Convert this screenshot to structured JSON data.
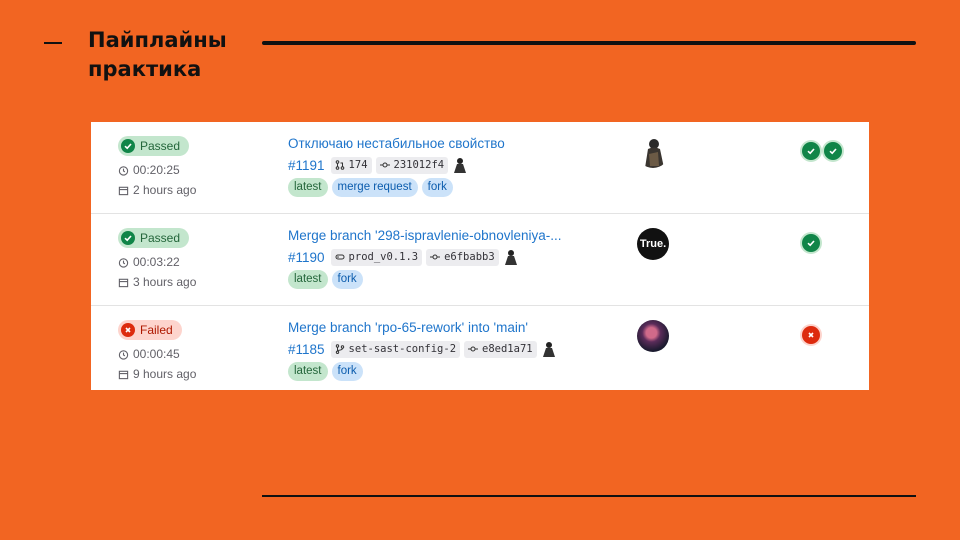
{
  "slide": {
    "title": "Пайплайны практика"
  },
  "pipelines": [
    {
      "status": "Passed",
      "status_kind": "passed",
      "duration": "00:20:25",
      "finished": "2 hours ago",
      "title": "Отключаю нестабильное свойство",
      "id": "#1191",
      "ref_icon": "merge-request-icon",
      "ref": "174",
      "commit": "231012f4",
      "tags": [
        "latest",
        "merge request",
        "fork"
      ],
      "avatar": "hooded-figure-avatar",
      "stages": [
        "success",
        "success"
      ]
    },
    {
      "status": "Passed",
      "status_kind": "passed",
      "duration": "00:03:22",
      "finished": "3 hours ago",
      "title": "Merge branch '298-ispravlenie-obnovleniya-...",
      "id": "#1190",
      "ref_icon": "tag-icon",
      "ref": "prod_v0.1.3",
      "commit": "e6fbabb3",
      "tags": [
        "latest",
        "fork"
      ],
      "avatar_text": "True.",
      "stages": [
        "success"
      ]
    },
    {
      "status": "Failed",
      "status_kind": "failed",
      "duration": "00:00:45",
      "finished": "9 hours ago",
      "title": "Merge branch 'rpo-65-rework' into 'main'",
      "id": "#1185",
      "ref_icon": "branch-icon",
      "ref": "set-sast-config-2",
      "commit": "e8ed1a71",
      "tags": [
        "latest",
        "fork"
      ],
      "avatar": "photo-avatar",
      "stages": [
        "failed"
      ]
    }
  ],
  "colors": {
    "background": "#f26522",
    "success": "#108548",
    "failed": "#dd2b0e",
    "link": "#1f75cb"
  }
}
